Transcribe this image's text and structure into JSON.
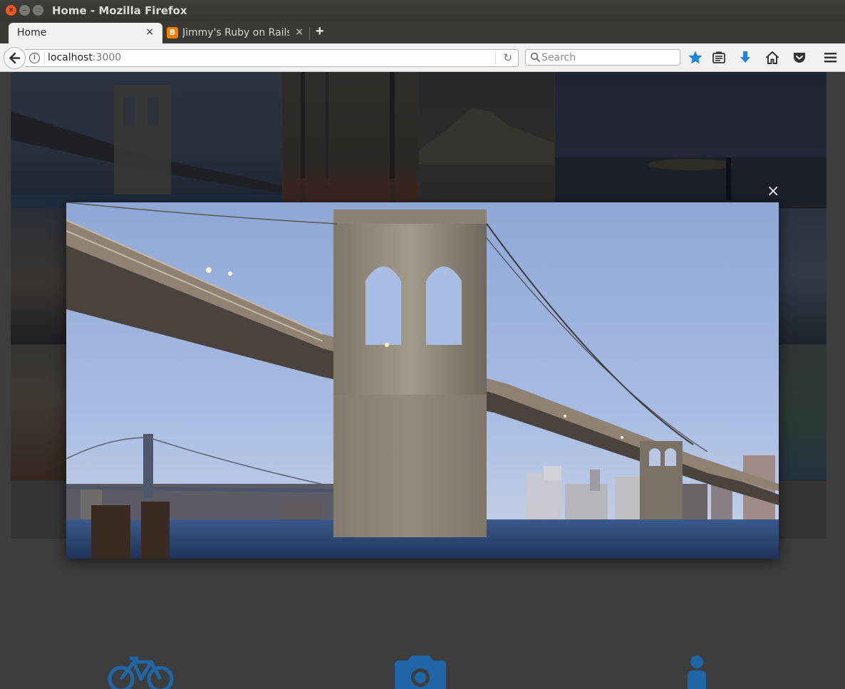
{
  "window": {
    "title": "Home - Mozilla Firefox",
    "close_glyph": "×",
    "min_glyph": "–",
    "max_glyph": "□"
  },
  "tabs": [
    {
      "label": "Home",
      "active": true,
      "close_glyph": "×"
    },
    {
      "label": "Jimmy's Ruby on Rails",
      "active": false,
      "favicon_letter": "B",
      "close_glyph": "×"
    }
  ],
  "newtab_glyph": "+",
  "nav": {
    "back_glyph": "🡐",
    "url_host": "localhost",
    "url_port": ":3000",
    "reload_glyph": "↻",
    "search_placeholder": "Search"
  },
  "toolbar_icons": [
    "star-bookmark-icon",
    "reading-list-icon",
    "download-icon",
    "home-icon",
    "pocket-icon",
    "hamburger-menu-icon"
  ],
  "lightbox": {
    "close_glyph": "×"
  },
  "gallery_tiles": [
    "brooklyn-bridge",
    "misty-forest",
    "mountain-lake",
    "night-fisherman",
    "sunset-beach",
    "sea-rocks",
    "clouds-mountain",
    "mountain-lake-green"
  ],
  "features": [
    {
      "icon": "bicycle-icon"
    },
    {
      "icon": "camera-icon"
    },
    {
      "icon": "person-icon"
    }
  ],
  "colors": {
    "accent_blue": "#1f66a8",
    "page_bg": "#3d3d3d",
    "titlebar_bg": "#3c3b37"
  }
}
